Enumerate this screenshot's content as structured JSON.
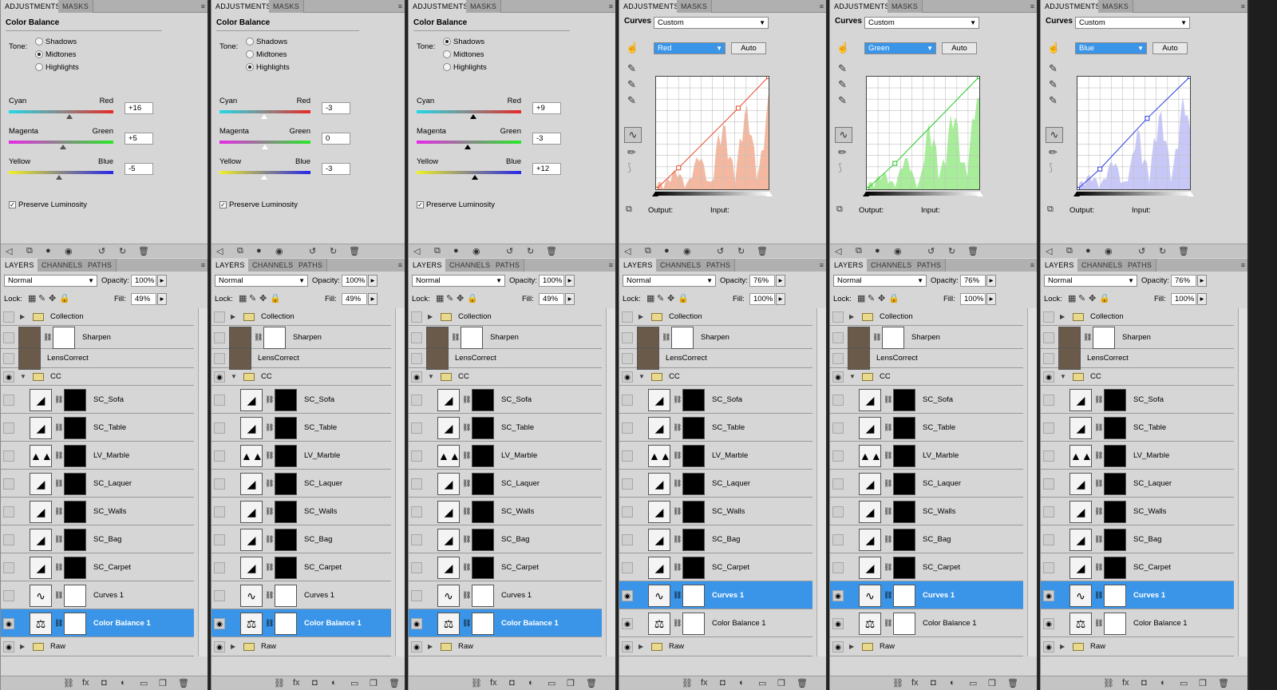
{
  "colors": {
    "accent": "#3a95e8",
    "panel": "#d6d6d6",
    "tabbar": "#b0b0b0"
  },
  "tabs": {
    "adjustments": "ADJUSTMENTS",
    "masks": "MASKS",
    "layers": "LAYERS",
    "channels": "CHANNELS",
    "paths": "PATHS"
  },
  "cb": {
    "title": "Color Balance",
    "tone_label": "Tone:",
    "shadows": "Shadows",
    "midtones": "Midtones",
    "highlights": "Highlights",
    "cyan": "Cyan",
    "red": "Red",
    "magenta": "Magenta",
    "green": "Green",
    "yellow": "Yellow",
    "blue": "Blue",
    "preserve": "Preserve Luminosity"
  },
  "cv": {
    "title": "Curves",
    "preset": "Custom",
    "auto": "Auto",
    "output": "Output:",
    "input": "Input:"
  },
  "lp": {
    "mode": "Normal",
    "opacity_label": "Opacity:",
    "lock_label": "Lock:",
    "fill_label": "Fill:"
  },
  "layer_names": {
    "collection": "Collection",
    "sharpen": "Sharpen",
    "lenscorrect": "LensCorrect",
    "cc": "CC",
    "sofa": "SC_Sofa",
    "table": "SC_Table",
    "marble": "LV_Marble",
    "laquer": "SC_Laquer",
    "walls": "SC_Walls",
    "bag": "SC_Bag",
    "carpet": "SC_Carpet",
    "curves": "Curves 1",
    "colorbalance": "Color Balance 1",
    "raw": "Raw"
  },
  "panels": [
    {
      "type": "cb",
      "tone": "midtones",
      "values": [
        "+16",
        "+5",
        "-5"
      ],
      "levels": [
        0.58,
        0.52,
        0.48
      ],
      "opacity": "100%",
      "fill": "49%",
      "selected": "colorbalance"
    },
    {
      "type": "cb",
      "tone": "highlights",
      "values": [
        "-3",
        "0",
        "-3"
      ],
      "levels": [
        0.49,
        0.5,
        0.49
      ],
      "opacity": "100%",
      "fill": "49%",
      "selected": "colorbalance"
    },
    {
      "type": "cb",
      "tone": "shadows",
      "values": [
        "+9",
        "-3",
        "+12"
      ],
      "levels": [
        0.545,
        0.485,
        0.56
      ],
      "opacity": "100%",
      "fill": "49%",
      "selected": "colorbalance"
    },
    {
      "type": "cv",
      "channel": "Red",
      "color": "#e84a2a",
      "hist": "#f4b8a0",
      "opacity": "76%",
      "fill": "100%",
      "selected": "curves",
      "points": [
        [
          0,
          0
        ],
        [
          0.2,
          0.19
        ],
        [
          0.73,
          0.72
        ],
        [
          1,
          1
        ]
      ]
    },
    {
      "type": "cv",
      "channel": "Green",
      "color": "#22c822",
      "hist": "#a8ee9a",
      "opacity": "76%",
      "fill": "100%",
      "selected": "curves",
      "points": [
        [
          0,
          0
        ],
        [
          0.25,
          0.23
        ],
        [
          1,
          1
        ]
      ]
    },
    {
      "type": "cv",
      "channel": "Blue",
      "color": "#2a3ae0",
      "hist": "#c8c8f8",
      "opacity": "76%",
      "fill": "100%",
      "selected": "curves",
      "points": [
        [
          0,
          0
        ],
        [
          0.2,
          0.18
        ],
        [
          0.62,
          0.63
        ],
        [
          1,
          1
        ]
      ]
    }
  ]
}
